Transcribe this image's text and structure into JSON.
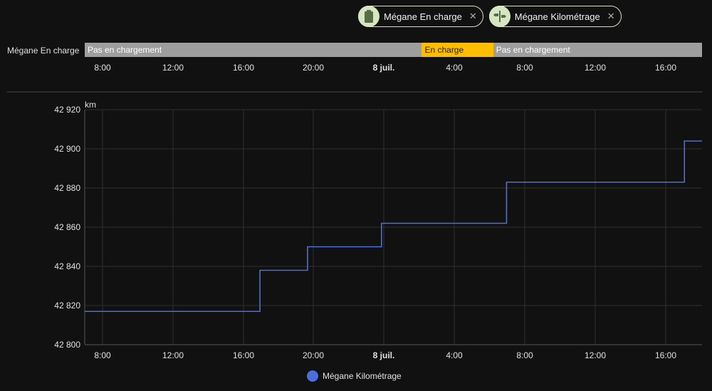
{
  "chips": [
    {
      "label": "Mégane En charge",
      "icon": "battery-icon",
      "close": "✕"
    },
    {
      "label": "Mégane Kilométrage",
      "icon": "road-sign-icon",
      "close": "✕"
    }
  ],
  "timeline": {
    "label": "Mégane En charge",
    "segments": [
      {
        "label": "Pas en chargement",
        "start": 0,
        "end": 0.5461,
        "color": "#9e9e9e"
      },
      {
        "label": "En charge",
        "start": 0.5461,
        "end": 0.6617,
        "color": "#fdbd00"
      },
      {
        "label": "Pas en chargement",
        "start": 0.6617,
        "end": 1,
        "color": "#9e9e9e"
      }
    ],
    "ticks": [
      "8:00",
      "12:00",
      "16:00",
      "20:00",
      "8 juil.",
      "4:00",
      "8:00",
      "12:00",
      "16:00"
    ]
  },
  "chart_data": {
    "type": "line",
    "step": true,
    "ylabel": "km",
    "y_ticks": [
      "42 920",
      "42 900",
      "42 880",
      "42 860",
      "42 840",
      "42 820",
      "42 800"
    ],
    "ylim": [
      42800,
      42920
    ],
    "x_ticks": [
      "8:00",
      "12:00",
      "16:00",
      "20:00",
      "8 juil.",
      "4:00",
      "8:00",
      "12:00",
      "16:00"
    ],
    "x_range_hours": [
      6.95,
      42.0
    ],
    "grid": true,
    "series": [
      {
        "name": "Mégane Kilométrage",
        "color": "#4b6fd8",
        "points": [
          {
            "t": 6.95,
            "km": 42817
          },
          {
            "t": 16.9,
            "km": 42838
          },
          {
            "t": 19.6,
            "km": 42850
          },
          {
            "t": 23.8,
            "km": 42862
          },
          {
            "t": 30.9,
            "km": 42883
          },
          {
            "t": 41.0,
            "km": 42904
          },
          {
            "t": 42.0,
            "km": 42904
          }
        ]
      }
    ]
  },
  "legend": {
    "label": "Mégane Kilométrage",
    "color": "#4b6fd8"
  }
}
